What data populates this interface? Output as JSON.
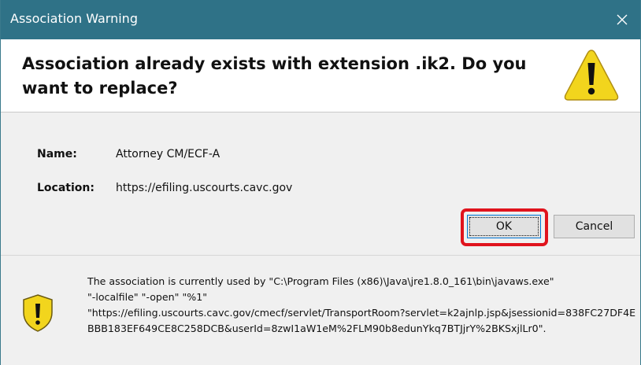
{
  "dialog": {
    "title": "Association Warning",
    "headline": "Association already exists with extension .ik2. Do you want to replace?"
  },
  "fields": {
    "name_label": "Name:",
    "name_value": "Attorney CM/ECF-A",
    "location_label": "Location:",
    "location_value": "https://efiling.uscourts.cavc.gov"
  },
  "buttons": {
    "ok": "OK",
    "cancel": "Cancel"
  },
  "details": {
    "text": "The association is currently used by \"C:\\Program Files (x86)\\Java\\jre1.8.0_161\\bin\\javaws.exe\"\n\"-localfile\" \"-open\" \"%1\"\n\"https://efiling.uscourts.cavc.gov/cmecf/servlet/TransportRoom?servlet=k2ajnlp.jsp&jsessionid=838FC27DF4EBBB183EF649CE8C258DCB&userId=8zwI1aW1eM%2FLM90b8edunYkq7BTJjrY%2BKSxjlLr0\"."
  },
  "icons": {
    "close": "close-icon",
    "warning_large": "warning-triangle-icon",
    "warning_small": "shield-warning-icon"
  },
  "colors": {
    "titlebar": "#2f7287",
    "highlight": "#e0131d",
    "warning": "#f2d51d"
  }
}
